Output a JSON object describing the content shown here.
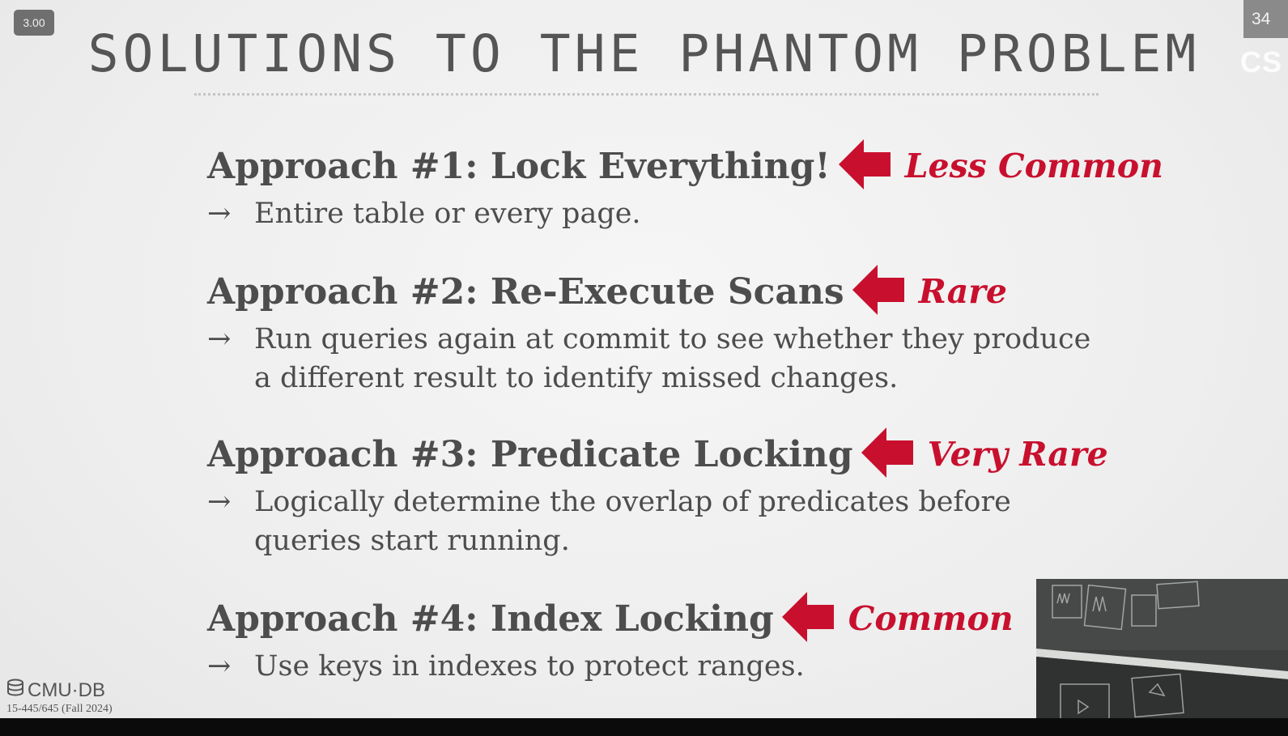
{
  "overlay": {
    "speed": "3.00",
    "slide_number": "34",
    "course_partial": "CS"
  },
  "slide": {
    "title": "SOLUTIONS TO THE PHANTOM PROBLEM",
    "approaches": [
      {
        "heading": "Approach #1: Lock Everything!",
        "tag": "Less Common",
        "bullet": "Entire table or every page."
      },
      {
        "heading": "Approach #2: Re-Execute Scans",
        "tag": "Rare",
        "bullet": "Run queries again at commit to see whether they produce a different result to identify missed changes."
      },
      {
        "heading": "Approach #3: Predicate Locking",
        "tag": "Very Rare",
        "bullet": "Logically determine the overlap of predicates before queries start running."
      },
      {
        "heading": "Approach #4: Index Locking",
        "tag": "Common",
        "bullet": "Use keys in indexes to protect ranges."
      }
    ],
    "bullet_symbol": "→",
    "footer": {
      "logo": "CMU·DB",
      "course": "15-445/645 (Fall 2024)"
    }
  },
  "colors": {
    "accent": "#c8102e",
    "text": "#4d4d4d"
  }
}
